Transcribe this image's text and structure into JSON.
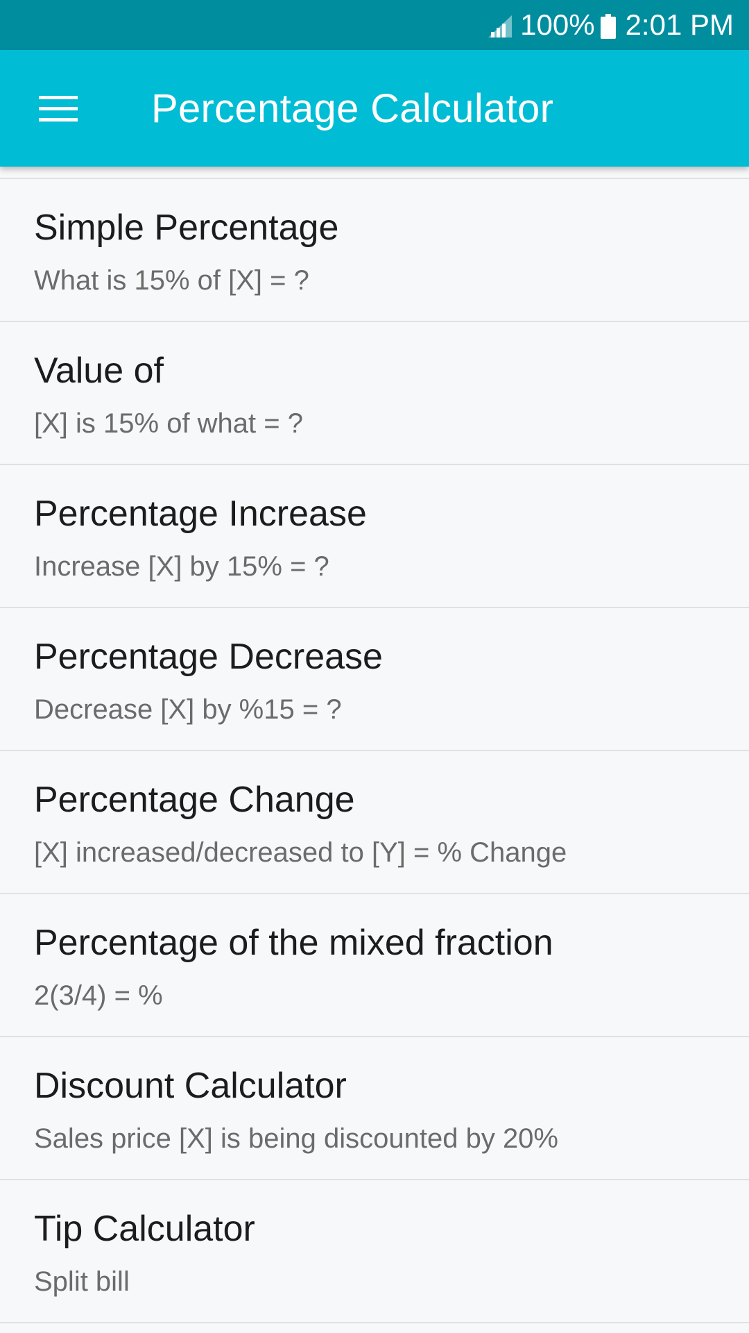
{
  "status_bar": {
    "battery": "100%",
    "time": "2:01 PM",
    "icons": [
      "signal-icon",
      "battery-icon"
    ]
  },
  "app_bar": {
    "title": "Percentage Calculator",
    "menu_icon": "hamburger-menu-icon",
    "background": "#00bcd4"
  },
  "list": {
    "items": [
      {
        "title": "Simple Percentage",
        "subtitle": "What is 15% of [X] = ?"
      },
      {
        "title": "Value of",
        "subtitle": "[X] is 15% of what = ?"
      },
      {
        "title": "Percentage Increase",
        "subtitle": "Increase [X] by 15% = ?"
      },
      {
        "title": "Percentage Decrease",
        "subtitle": "Decrease [X] by %15 = ?"
      },
      {
        "title": "Percentage Change",
        "subtitle": "[X] increased/decreased to [Y] = % Change"
      },
      {
        "title": "Percentage of the mixed fraction",
        "subtitle": "2(3/4) = %"
      },
      {
        "title": "Discount Calculator",
        "subtitle": "Sales price [X] is being discounted by 20%"
      },
      {
        "title": "Tip Calculator",
        "subtitle": "Split bill"
      }
    ]
  }
}
